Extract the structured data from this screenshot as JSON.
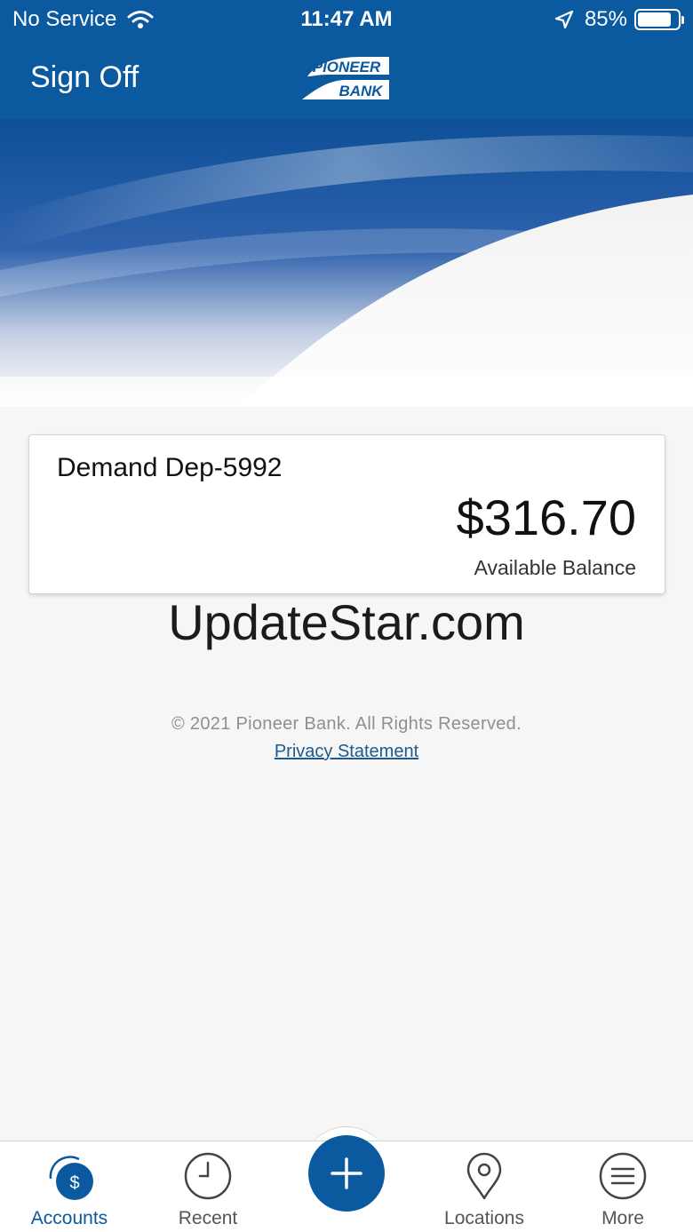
{
  "status_bar": {
    "carrier": "No Service",
    "time": "11:47 AM",
    "battery_percent": "85%",
    "battery_level": 0.85,
    "icons": [
      "wifi-icon",
      "location-arrow-icon",
      "battery-icon"
    ]
  },
  "nav": {
    "sign_off_label": "Sign Off",
    "logo": {
      "line1": "PIONEER",
      "line2": "BANK"
    }
  },
  "account": {
    "name": "Demand Dep-5992",
    "balance": "$316.70",
    "balance_label": "Available Balance"
  },
  "watermark": "UpdateStar.com",
  "footer": {
    "copyright": "© 2021 Pioneer Bank. All Rights Reserved.",
    "privacy_link": "Privacy Statement"
  },
  "tabs": [
    {
      "label": "Accounts",
      "icon": "accounts-dollar-icon",
      "active": true
    },
    {
      "label": "Recent",
      "icon": "clock-icon",
      "active": false
    },
    {
      "label": "",
      "icon": "plus-icon",
      "active": false
    },
    {
      "label": "Locations",
      "icon": "map-pin-icon",
      "active": false
    },
    {
      "label": "More",
      "icon": "menu-icon",
      "active": false
    }
  ],
  "colors": {
    "brand_blue": "#0b5aa0",
    "background": "#f6f6f6",
    "link": "#1c5a8f"
  }
}
